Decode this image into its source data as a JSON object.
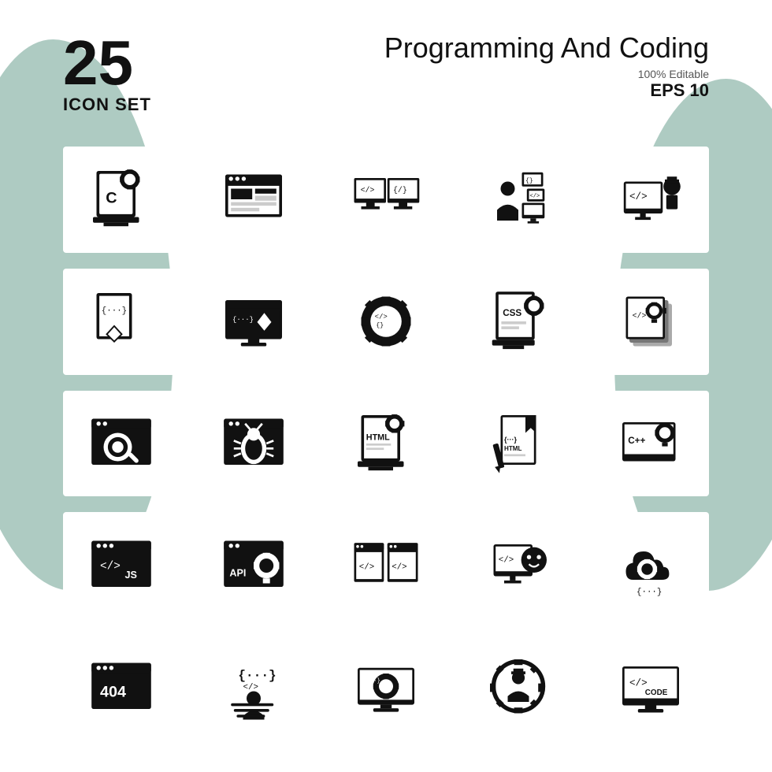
{
  "header": {
    "number": "25",
    "icon_set_label": "ICON SET",
    "title": "Programming And Coding",
    "editable": "100% Editable",
    "eps": "EPS 10"
  },
  "icons": [
    {
      "name": "c-programming",
      "row": 1,
      "col": 1
    },
    {
      "name": "web-layout",
      "row": 1,
      "col": 2
    },
    {
      "name": "dual-monitor-code",
      "row": 1,
      "col": 3
    },
    {
      "name": "online-learning",
      "row": 1,
      "col": 4
    },
    {
      "name": "code-teacher",
      "row": 1,
      "col": 5
    },
    {
      "name": "ruby-file",
      "row": 2,
      "col": 1
    },
    {
      "name": "diamond-monitor",
      "row": 2,
      "col": 2
    },
    {
      "name": "gear-code",
      "row": 2,
      "col": 3
    },
    {
      "name": "css-file",
      "row": 2,
      "col": 4
    },
    {
      "name": "code-layers",
      "row": 2,
      "col": 5
    },
    {
      "name": "search-browser",
      "row": 3,
      "col": 1
    },
    {
      "name": "bug-browser",
      "row": 3,
      "col": 2
    },
    {
      "name": "html-settings",
      "row": 3,
      "col": 3
    },
    {
      "name": "html-book",
      "row": 3,
      "col": 4
    },
    {
      "name": "cpp-code",
      "row": 3,
      "col": 5
    },
    {
      "name": "js-browser",
      "row": 4,
      "col": 1
    },
    {
      "name": "api-settings",
      "row": 4,
      "col": 2
    },
    {
      "name": "code-browser",
      "row": 4,
      "col": 3
    },
    {
      "name": "monitor-face",
      "row": 4,
      "col": 4
    },
    {
      "name": "cloud-gear",
      "row": 4,
      "col": 5
    },
    {
      "name": "404-browser",
      "row": 5,
      "col": 1
    },
    {
      "name": "developer",
      "row": 5,
      "col": 2
    },
    {
      "name": "monitor-gear",
      "row": 5,
      "col": 3
    },
    {
      "name": "gear-person",
      "row": 5,
      "col": 4
    },
    {
      "name": "code-monitor",
      "row": 5,
      "col": 5
    }
  ]
}
